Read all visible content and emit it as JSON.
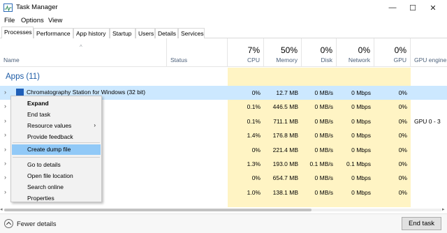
{
  "window": {
    "title": "Task Manager",
    "controls": {
      "minimize": "—",
      "maximize": "☐",
      "close": "✕"
    }
  },
  "menu": [
    "File",
    "Options",
    "View"
  ],
  "tabs": [
    "Processes",
    "Performance",
    "App history",
    "Startup",
    "Users",
    "Details",
    "Services"
  ],
  "columns": {
    "name": "Name",
    "status": "Status",
    "cpu": {
      "pct": "7%",
      "label": "CPU"
    },
    "memory": {
      "pct": "50%",
      "label": "Memory"
    },
    "disk": {
      "pct": "0%",
      "label": "Disk"
    },
    "network": {
      "pct": "0%",
      "label": "Network"
    },
    "gpu": {
      "pct": "0%",
      "label": "GPU"
    },
    "gpu_engine": {
      "label": "GPU engine"
    },
    "sort_caret": "^"
  },
  "group": {
    "title": "Apps (11)"
  },
  "rows": [
    {
      "name": "Chromatography Station for Windows (32 bit)",
      "cpu": "0%",
      "memory": "12.7 MB",
      "disk": "0 MB/s",
      "network": "0 Mbps",
      "gpu": "0%",
      "gpu_engine": ""
    },
    {
      "name": "",
      "cpu": "0.1%",
      "memory": "446.5 MB",
      "disk": "0 MB/s",
      "network": "0 Mbps",
      "gpu": "0%",
      "gpu_engine": ""
    },
    {
      "name": "",
      "cpu": "0.1%",
      "memory": "711.1 MB",
      "disk": "0 MB/s",
      "network": "0 Mbps",
      "gpu": "0%",
      "gpu_engine": "GPU 0 - 3"
    },
    {
      "name": "",
      "cpu": "1.4%",
      "memory": "176.8 MB",
      "disk": "0 MB/s",
      "network": "0 Mbps",
      "gpu": "0%",
      "gpu_engine": ""
    },
    {
      "name": "",
      "cpu": "0%",
      "memory": "221.4 MB",
      "disk": "0 MB/s",
      "network": "0 Mbps",
      "gpu": "0%",
      "gpu_engine": ""
    },
    {
      "name": "",
      "cpu": "1.3%",
      "memory": "193.0 MB",
      "disk": "0.1 MB/s",
      "network": "0.1 Mbps",
      "gpu": "0%",
      "gpu_engine": ""
    },
    {
      "name": "",
      "cpu": "0%",
      "memory": "654.7 MB",
      "disk": "0 MB/s",
      "network": "0 Mbps",
      "gpu": "0%",
      "gpu_engine": ""
    },
    {
      "name": "",
      "cpu": "1.0%",
      "memory": "138.1 MB",
      "disk": "0 MB/s",
      "network": "0 Mbps",
      "gpu": "0%",
      "gpu_engine": ""
    }
  ],
  "context_menu": {
    "items": [
      {
        "label": "Expand",
        "bold": true
      },
      {
        "label": "End task"
      },
      {
        "label": "Resource values",
        "submenu": "›"
      },
      {
        "label": "Provide feedback"
      },
      {
        "label": "Create dump file",
        "highlighted": true
      },
      {
        "label": "Go to details"
      },
      {
        "label": "Open file location"
      },
      {
        "label": "Search online"
      },
      {
        "label": "Properties"
      }
    ]
  },
  "footer": {
    "fewer_details": "Fewer details",
    "end_task": "End task"
  },
  "colors": {
    "heat_light": "#fff4c4",
    "heat_mid": "#ffefb0",
    "selected_row": "#cce8ff",
    "menu_highlight": "#91c9f7",
    "group_title": "#1e5ca6"
  }
}
